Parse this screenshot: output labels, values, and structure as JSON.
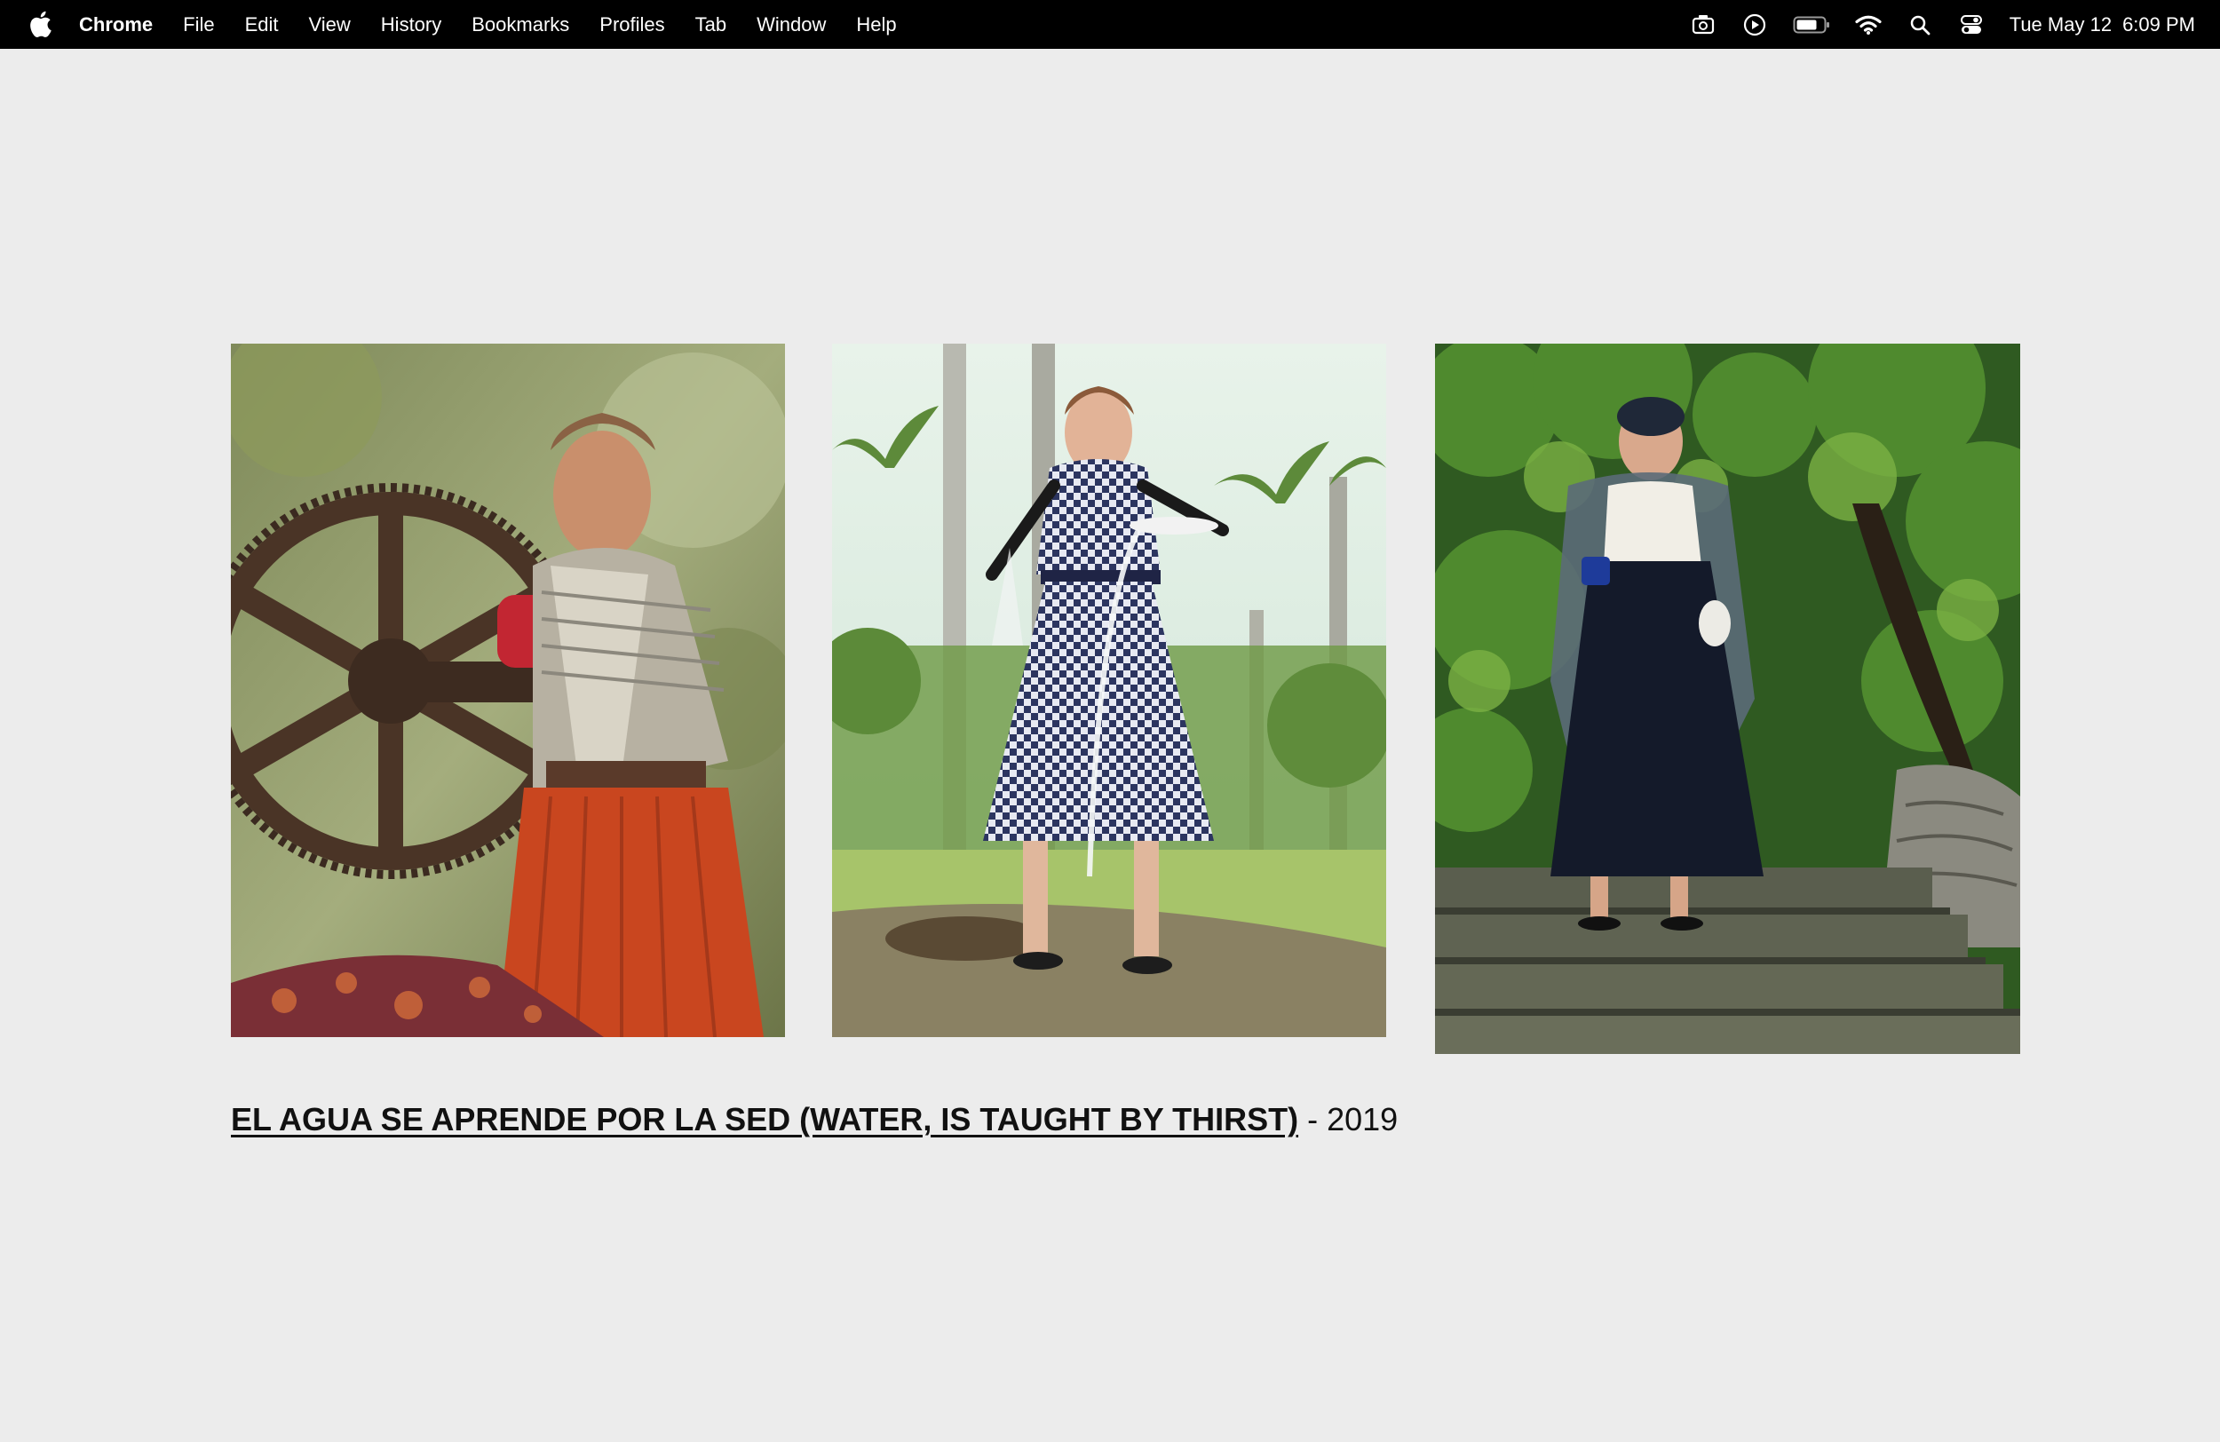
{
  "menubar": {
    "app_name": "Chrome",
    "items": [
      "File",
      "Edit",
      "View",
      "History",
      "Bookmarks",
      "Profiles",
      "Tab",
      "Window",
      "Help"
    ],
    "clock_date": "Tue May 12",
    "clock_time": "6:09 PM"
  },
  "work": {
    "title": "EL AGUA SE APRENDE POR LA SED (WATER, IS TAUGHT BY THIRST)",
    "year_suffix": "- 2019"
  },
  "colors": {
    "page_bg": "#ececec",
    "menubar_bg": "#000000",
    "text": "#111111"
  }
}
